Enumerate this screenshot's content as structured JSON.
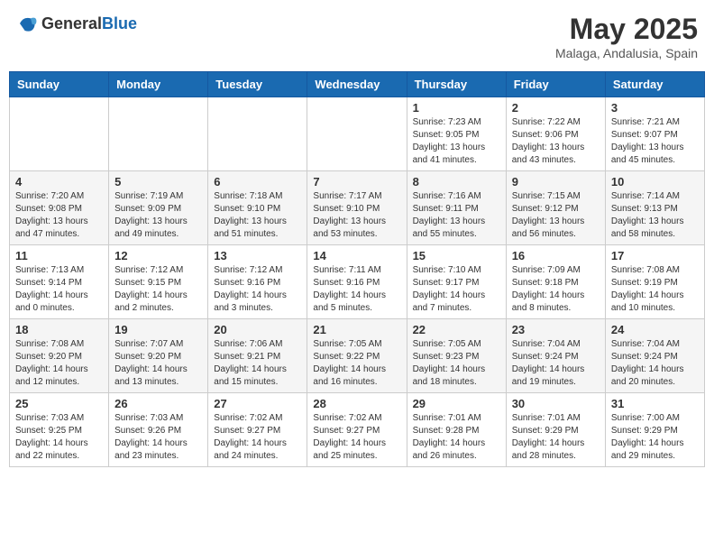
{
  "logo": {
    "text_general": "General",
    "text_blue": "Blue"
  },
  "title": {
    "month": "May 2025",
    "location": "Malaga, Andalusia, Spain"
  },
  "weekdays": [
    "Sunday",
    "Monday",
    "Tuesday",
    "Wednesday",
    "Thursday",
    "Friday",
    "Saturday"
  ],
  "weeks": [
    [
      {
        "date": "",
        "sunrise": "",
        "sunset": "",
        "daylight": ""
      },
      {
        "date": "",
        "sunrise": "",
        "sunset": "",
        "daylight": ""
      },
      {
        "date": "",
        "sunrise": "",
        "sunset": "",
        "daylight": ""
      },
      {
        "date": "",
        "sunrise": "",
        "sunset": "",
        "daylight": ""
      },
      {
        "date": "1",
        "sunrise": "Sunrise: 7:23 AM",
        "sunset": "Sunset: 9:05 PM",
        "daylight": "Daylight: 13 hours and 41 minutes."
      },
      {
        "date": "2",
        "sunrise": "Sunrise: 7:22 AM",
        "sunset": "Sunset: 9:06 PM",
        "daylight": "Daylight: 13 hours and 43 minutes."
      },
      {
        "date": "3",
        "sunrise": "Sunrise: 7:21 AM",
        "sunset": "Sunset: 9:07 PM",
        "daylight": "Daylight: 13 hours and 45 minutes."
      }
    ],
    [
      {
        "date": "4",
        "sunrise": "Sunrise: 7:20 AM",
        "sunset": "Sunset: 9:08 PM",
        "daylight": "Daylight: 13 hours and 47 minutes."
      },
      {
        "date": "5",
        "sunrise": "Sunrise: 7:19 AM",
        "sunset": "Sunset: 9:09 PM",
        "daylight": "Daylight: 13 hours and 49 minutes."
      },
      {
        "date": "6",
        "sunrise": "Sunrise: 7:18 AM",
        "sunset": "Sunset: 9:10 PM",
        "daylight": "Daylight: 13 hours and 51 minutes."
      },
      {
        "date": "7",
        "sunrise": "Sunrise: 7:17 AM",
        "sunset": "Sunset: 9:10 PM",
        "daylight": "Daylight: 13 hours and 53 minutes."
      },
      {
        "date": "8",
        "sunrise": "Sunrise: 7:16 AM",
        "sunset": "Sunset: 9:11 PM",
        "daylight": "Daylight: 13 hours and 55 minutes."
      },
      {
        "date": "9",
        "sunrise": "Sunrise: 7:15 AM",
        "sunset": "Sunset: 9:12 PM",
        "daylight": "Daylight: 13 hours and 56 minutes."
      },
      {
        "date": "10",
        "sunrise": "Sunrise: 7:14 AM",
        "sunset": "Sunset: 9:13 PM",
        "daylight": "Daylight: 13 hours and 58 minutes."
      }
    ],
    [
      {
        "date": "11",
        "sunrise": "Sunrise: 7:13 AM",
        "sunset": "Sunset: 9:14 PM",
        "daylight": "Daylight: 14 hours and 0 minutes."
      },
      {
        "date": "12",
        "sunrise": "Sunrise: 7:12 AM",
        "sunset": "Sunset: 9:15 PM",
        "daylight": "Daylight: 14 hours and 2 minutes."
      },
      {
        "date": "13",
        "sunrise": "Sunrise: 7:12 AM",
        "sunset": "Sunset: 9:16 PM",
        "daylight": "Daylight: 14 hours and 3 minutes."
      },
      {
        "date": "14",
        "sunrise": "Sunrise: 7:11 AM",
        "sunset": "Sunset: 9:16 PM",
        "daylight": "Daylight: 14 hours and 5 minutes."
      },
      {
        "date": "15",
        "sunrise": "Sunrise: 7:10 AM",
        "sunset": "Sunset: 9:17 PM",
        "daylight": "Daylight: 14 hours and 7 minutes."
      },
      {
        "date": "16",
        "sunrise": "Sunrise: 7:09 AM",
        "sunset": "Sunset: 9:18 PM",
        "daylight": "Daylight: 14 hours and 8 minutes."
      },
      {
        "date": "17",
        "sunrise": "Sunrise: 7:08 AM",
        "sunset": "Sunset: 9:19 PM",
        "daylight": "Daylight: 14 hours and 10 minutes."
      }
    ],
    [
      {
        "date": "18",
        "sunrise": "Sunrise: 7:08 AM",
        "sunset": "Sunset: 9:20 PM",
        "daylight": "Daylight: 14 hours and 12 minutes."
      },
      {
        "date": "19",
        "sunrise": "Sunrise: 7:07 AM",
        "sunset": "Sunset: 9:20 PM",
        "daylight": "Daylight: 14 hours and 13 minutes."
      },
      {
        "date": "20",
        "sunrise": "Sunrise: 7:06 AM",
        "sunset": "Sunset: 9:21 PM",
        "daylight": "Daylight: 14 hours and 15 minutes."
      },
      {
        "date": "21",
        "sunrise": "Sunrise: 7:05 AM",
        "sunset": "Sunset: 9:22 PM",
        "daylight": "Daylight: 14 hours and 16 minutes."
      },
      {
        "date": "22",
        "sunrise": "Sunrise: 7:05 AM",
        "sunset": "Sunset: 9:23 PM",
        "daylight": "Daylight: 14 hours and 18 minutes."
      },
      {
        "date": "23",
        "sunrise": "Sunrise: 7:04 AM",
        "sunset": "Sunset: 9:24 PM",
        "daylight": "Daylight: 14 hours and 19 minutes."
      },
      {
        "date": "24",
        "sunrise": "Sunrise: 7:04 AM",
        "sunset": "Sunset: 9:24 PM",
        "daylight": "Daylight: 14 hours and 20 minutes."
      }
    ],
    [
      {
        "date": "25",
        "sunrise": "Sunrise: 7:03 AM",
        "sunset": "Sunset: 9:25 PM",
        "daylight": "Daylight: 14 hours and 22 minutes."
      },
      {
        "date": "26",
        "sunrise": "Sunrise: 7:03 AM",
        "sunset": "Sunset: 9:26 PM",
        "daylight": "Daylight: 14 hours and 23 minutes."
      },
      {
        "date": "27",
        "sunrise": "Sunrise: 7:02 AM",
        "sunset": "Sunset: 9:27 PM",
        "daylight": "Daylight: 14 hours and 24 minutes."
      },
      {
        "date": "28",
        "sunrise": "Sunrise: 7:02 AM",
        "sunset": "Sunset: 9:27 PM",
        "daylight": "Daylight: 14 hours and 25 minutes."
      },
      {
        "date": "29",
        "sunrise": "Sunrise: 7:01 AM",
        "sunset": "Sunset: 9:28 PM",
        "daylight": "Daylight: 14 hours and 26 minutes."
      },
      {
        "date": "30",
        "sunrise": "Sunrise: 7:01 AM",
        "sunset": "Sunset: 9:29 PM",
        "daylight": "Daylight: 14 hours and 28 minutes."
      },
      {
        "date": "31",
        "sunrise": "Sunrise: 7:00 AM",
        "sunset": "Sunset: 9:29 PM",
        "daylight": "Daylight: 14 hours and 29 minutes."
      }
    ]
  ]
}
